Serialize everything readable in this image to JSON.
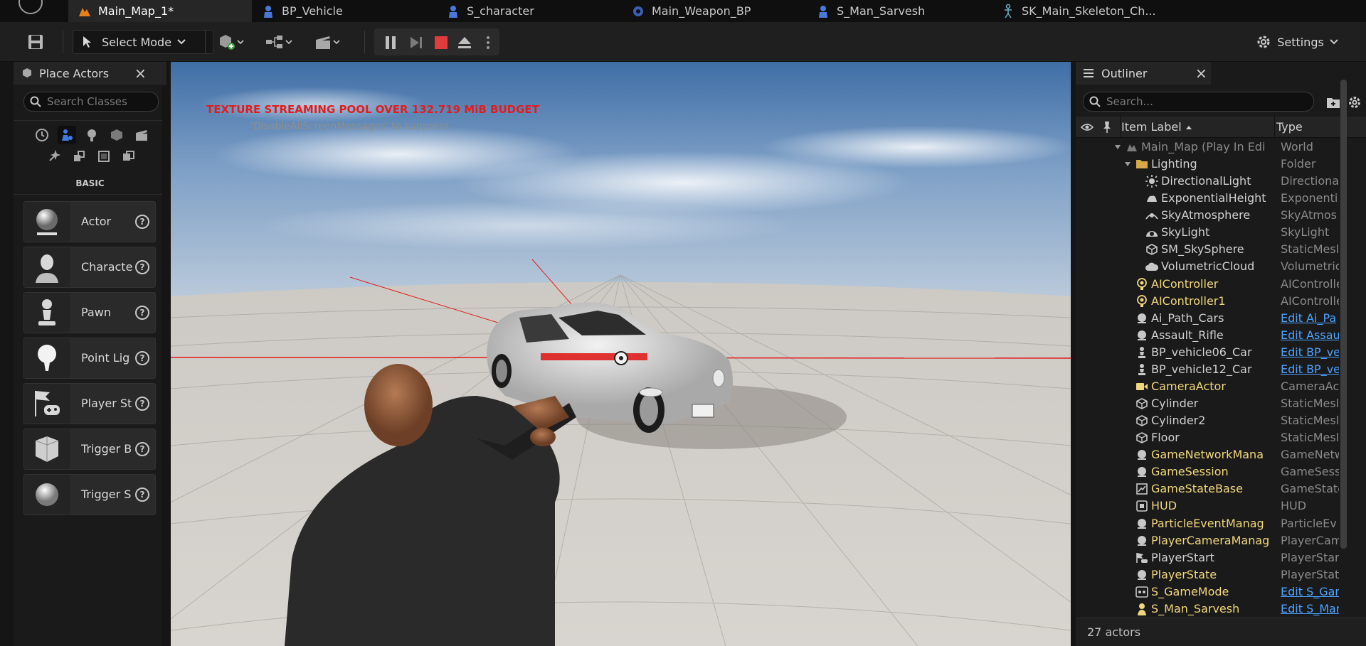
{
  "tabs": [
    {
      "label": "Main_Map_1*",
      "icon": "map-icon",
      "active": true
    },
    {
      "label": "BP_Vehicle",
      "icon": "blueprint-icon"
    },
    {
      "label": "S_character",
      "icon": "blueprint-icon"
    },
    {
      "label": "Main_Weapon_BP",
      "icon": "blueprint-icon"
    },
    {
      "label": "S_Man_Sarvesh",
      "icon": "blueprint-icon"
    },
    {
      "label": "SK_Main_Skeleton_Ch...",
      "icon": "skeleton-icon"
    }
  ],
  "toolbar": {
    "select_mode": "Select Mode",
    "settings": "Settings"
  },
  "place_actors": {
    "title": "Place Actors",
    "search_placeholder": "Search Classes",
    "category_label": "BASIC",
    "items": [
      {
        "label": "Actor",
        "icon": "sphere-icon"
      },
      {
        "label": "Characte",
        "icon": "character-icon"
      },
      {
        "label": "Pawn",
        "icon": "pawn-icon"
      },
      {
        "label": "Point Lig",
        "icon": "light-bulb-icon"
      },
      {
        "label": "Player St",
        "icon": "player-start-icon"
      },
      {
        "label": "Trigger B",
        "icon": "trigger-box-icon"
      },
      {
        "label": "Trigger S",
        "icon": "trigger-sphere-icon"
      }
    ]
  },
  "viewport": {
    "warning": "TEXTURE STREAMING POOL OVER 132.719 MiB BUDGET",
    "hint": "'DisableAllScreenMessages' to suppress",
    "accent_warning_color": "#e01e1e"
  },
  "outliner": {
    "title": "Outliner",
    "search_placeholder": "Search...",
    "col_label": "Item Label",
    "col_type": "Type",
    "footer": "27 actors",
    "rows": [
      {
        "label": "Main_Map (Play In Edi",
        "type": "World",
        "indent": 0,
        "color": "dim",
        "icon": "map-icon",
        "arrow": true
      },
      {
        "label": "Lighting",
        "type": "Folder",
        "indent": 1,
        "color": "white",
        "icon": "folder-icon",
        "arrow": true
      },
      {
        "label": "DirectionalLight",
        "type": "Directiona",
        "indent": 2,
        "color": "white",
        "icon": "sun-icon"
      },
      {
        "label": "ExponentialHeight",
        "type": "Exponenti",
        "indent": 2,
        "color": "white",
        "icon": "fog-icon"
      },
      {
        "label": "SkyAtmosphere",
        "type": "SkyAtmos",
        "indent": 2,
        "color": "white",
        "icon": "sky-atmosphere-icon"
      },
      {
        "label": "SkyLight",
        "type": "SkyLight",
        "indent": 2,
        "color": "white",
        "icon": "skylight-icon"
      },
      {
        "label": "SM_SkySphere",
        "type": "StaticMesl",
        "indent": 2,
        "color": "white",
        "icon": "static-mesh-icon"
      },
      {
        "label": "VolumetricCloud",
        "type": "Volumetric",
        "indent": 2,
        "color": "white",
        "icon": "cloud-icon"
      },
      {
        "label": "AIController",
        "type": "AIControlle",
        "indent": 1,
        "color": "yellow",
        "icon": "controller-icon"
      },
      {
        "label": "AIController1",
        "type": "AIControlle",
        "indent": 1,
        "color": "yellow",
        "icon": "controller-icon"
      },
      {
        "label": "Ai_Path_Cars",
        "type": "Edit Ai_Pa",
        "indent": 1,
        "color": "white",
        "icon": "actor-icon",
        "link": true
      },
      {
        "label": "Assault_Rifle",
        "type": "Edit Assau",
        "indent": 1,
        "color": "white",
        "icon": "actor-icon",
        "link": true
      },
      {
        "label": "BP_vehicle06_Car",
        "type": "Edit BP_ve",
        "indent": 1,
        "color": "white",
        "icon": "pawn-icon",
        "link": true
      },
      {
        "label": "BP_vehicle12_Car",
        "type": "Edit BP_ve",
        "indent": 1,
        "color": "white",
        "icon": "pawn-icon",
        "link": true
      },
      {
        "label": "CameraActor",
        "type": "CameraAc",
        "indent": 1,
        "color": "yellow",
        "icon": "camera-icon"
      },
      {
        "label": "Cylinder",
        "type": "StaticMesl",
        "indent": 1,
        "color": "white",
        "icon": "static-mesh-icon"
      },
      {
        "label": "Cylinder2",
        "type": "StaticMesl",
        "indent": 1,
        "color": "white",
        "icon": "static-mesh-icon"
      },
      {
        "label": "Floor",
        "type": "StaticMesl",
        "indent": 1,
        "color": "white",
        "icon": "static-mesh-icon"
      },
      {
        "label": "GameNetworkMana",
        "type": "GameNetw",
        "indent": 1,
        "color": "yellow",
        "icon": "actor-icon"
      },
      {
        "label": "GameSession",
        "type": "GameSess",
        "indent": 1,
        "color": "yellow",
        "icon": "actor-icon"
      },
      {
        "label": "GameStateBase",
        "type": "GameState",
        "indent": 1,
        "color": "yellow",
        "icon": "game-state-icon"
      },
      {
        "label": "HUD",
        "type": "HUD",
        "indent": 1,
        "color": "yellow",
        "icon": "hud-icon"
      },
      {
        "label": "ParticleEventManag",
        "type": "ParticleEv",
        "indent": 1,
        "color": "yellow",
        "icon": "actor-icon"
      },
      {
        "label": "PlayerCameraManag",
        "type": "PlayerCam",
        "indent": 1,
        "color": "yellow",
        "icon": "actor-icon"
      },
      {
        "label": "PlayerStart",
        "type": "PlayerStar",
        "indent": 1,
        "color": "white",
        "icon": "player-start-icon"
      },
      {
        "label": "PlayerState",
        "type": "PlayerStat",
        "indent": 1,
        "color": "yellow",
        "icon": "actor-icon"
      },
      {
        "label": "S_GameMode",
        "type": "Edit S_Gar",
        "indent": 1,
        "color": "yellow",
        "icon": "game-mode-icon",
        "link": true
      },
      {
        "label": "S_Man_Sarvesh",
        "type": "Edit S_Mar",
        "indent": 1,
        "color": "yellow",
        "icon": "character-icon",
        "link": true
      }
    ]
  }
}
